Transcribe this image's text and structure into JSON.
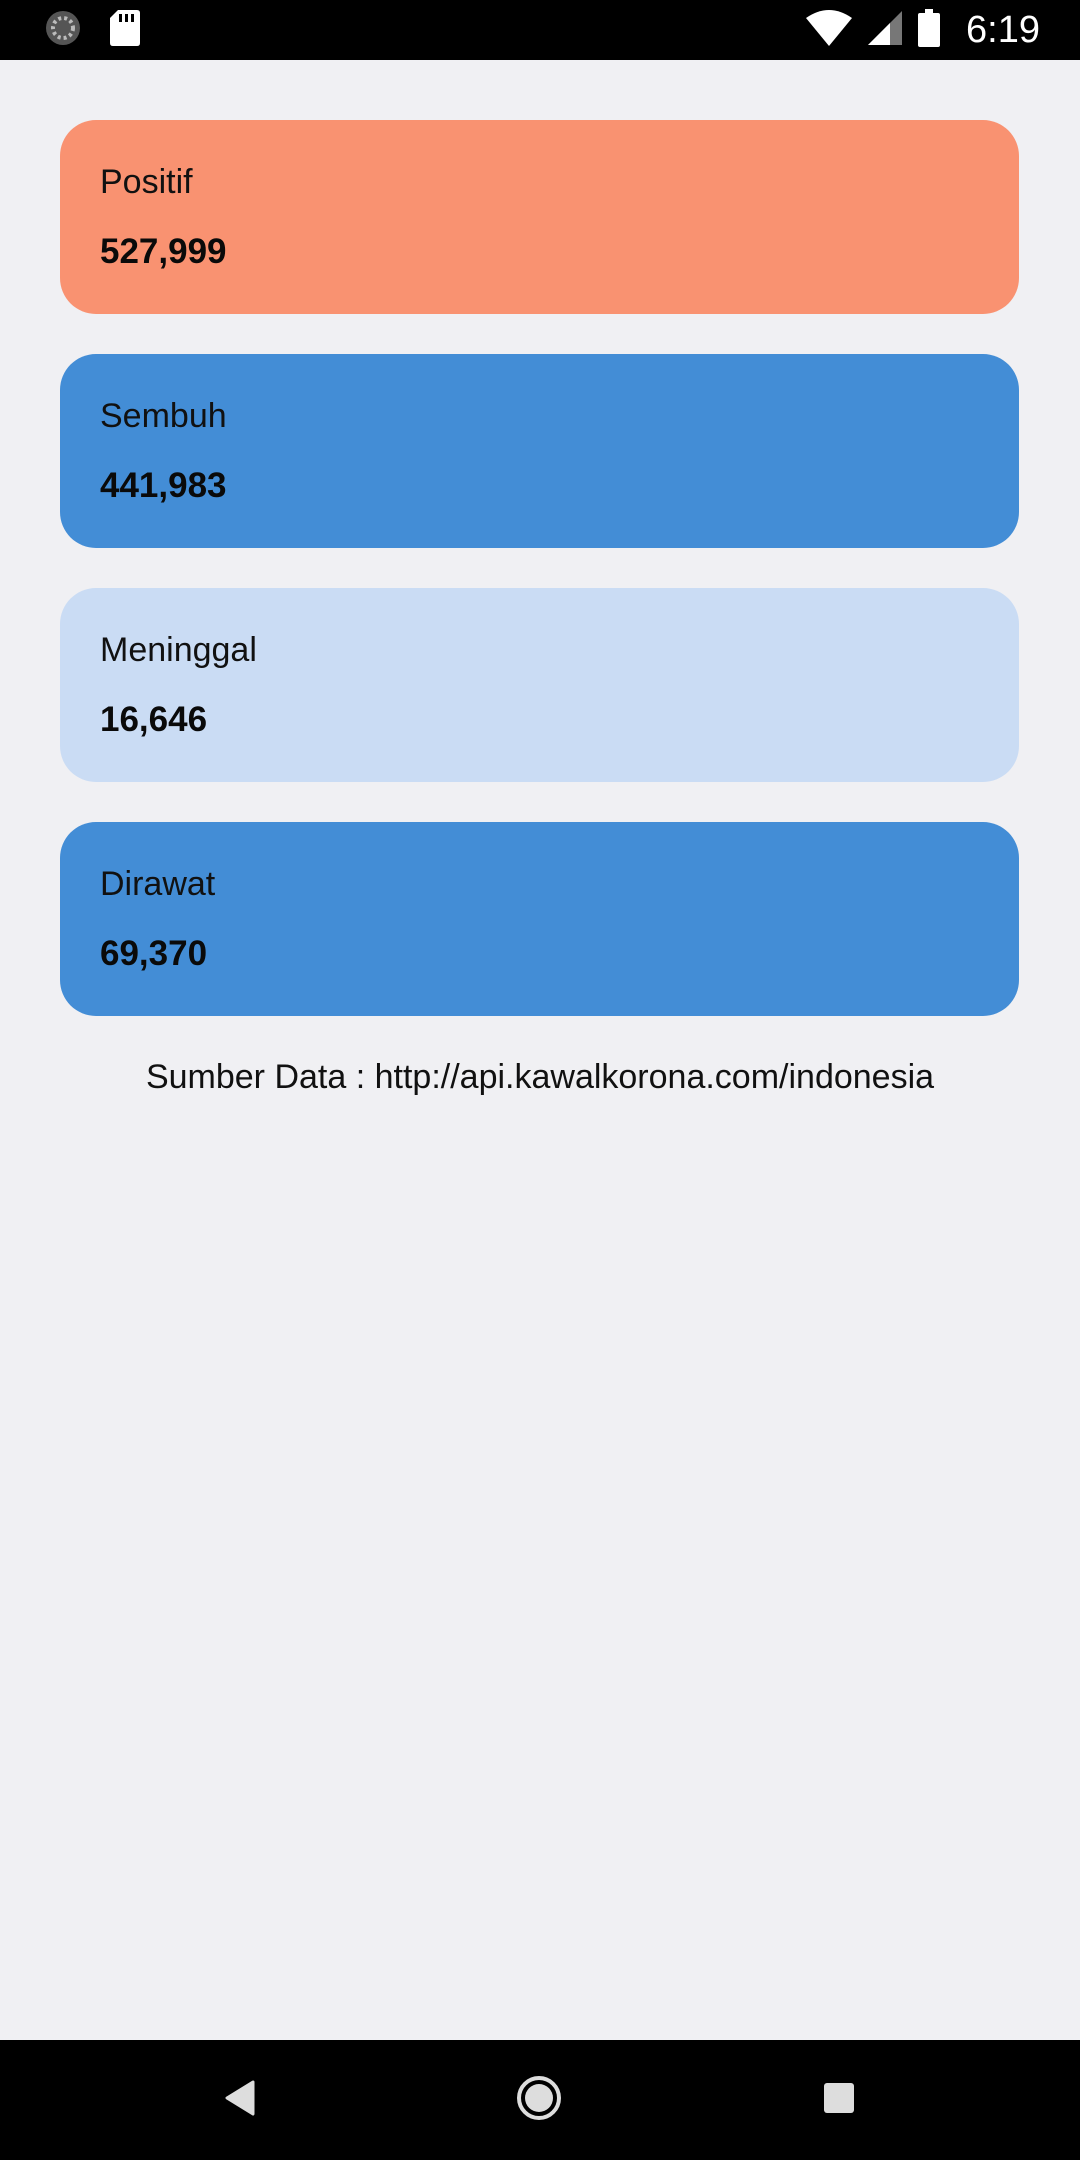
{
  "status_bar": {
    "time": "6:19",
    "icons": [
      "sync-icon",
      "sd-card-icon",
      "wifi-icon",
      "signal-icon",
      "battery-icon"
    ]
  },
  "cards": [
    {
      "label": "Positif",
      "value": "527,999",
      "color": "#f99271"
    },
    {
      "label": "Sembuh",
      "value": "441,983",
      "color": "#438dd6"
    },
    {
      "label": "Meninggal",
      "value": "16,646",
      "color": "#cadcf4"
    },
    {
      "label": "Dirawat",
      "value": "69,370",
      "color": "#438dd6"
    }
  ],
  "source_text": "Sumber Data : http://api.kawalkorona.com/indonesia",
  "nav_bar": {
    "icons": [
      "back-icon",
      "home-icon",
      "recents-icon"
    ]
  }
}
